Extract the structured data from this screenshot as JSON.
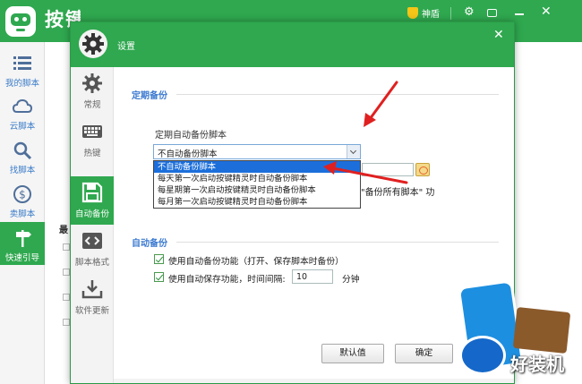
{
  "app": {
    "title": "按键精灵",
    "vip_label": "神盾"
  },
  "sidebar": {
    "items": [
      {
        "label": "我的脚本",
        "icon": "list-icon"
      },
      {
        "label": "云脚本",
        "icon": "cloud-icon"
      },
      {
        "label": "找脚本",
        "icon": "search-icon"
      },
      {
        "label": "卖脚本",
        "icon": "dollar-icon"
      },
      {
        "label": "快速引导",
        "icon": "signpost-icon"
      }
    ]
  },
  "main": {
    "partial_heading": "最"
  },
  "dialog": {
    "title": "设置",
    "nav": [
      {
        "label": "常规",
        "icon": "gear-icon"
      },
      {
        "label": "热键",
        "icon": "keyboard-icon"
      },
      {
        "label": "自动备份",
        "icon": "floppy-disk-icon"
      },
      {
        "label": "脚本格式",
        "icon": "code-icon"
      },
      {
        "label": "软件更新",
        "icon": "download-icon"
      }
    ],
    "scheduled_backup": {
      "section_title": "定期备份",
      "sub_label": "定期自动备份脚本",
      "selected": "不自动备份脚本",
      "options": [
        "不自动备份脚本",
        "每天第一次启动按键精灵时自动备份脚本",
        "每星期第一次启动按键精灵时自动备份脚本",
        "每月第一次启动按键精灵时自动备份脚本"
      ],
      "partial_text": "\"备份所有脚本\" 功"
    },
    "auto_backup": {
      "section_title": "自动备份",
      "option1_label": "使用自动备份功能（打开、保存脚本时备份）",
      "option2_label": "使用自动保存功能，时间间隔:",
      "interval_value": "10",
      "interval_unit": "分钟"
    },
    "buttons": {
      "default_label": "默认值",
      "ok_label": "确定"
    }
  },
  "watermark": {
    "text": "好装机"
  },
  "colors": {
    "accent_green": "#2fa84f",
    "section_blue": "#3c7ad0",
    "selection_blue": "#1c6fdb",
    "annotation_red": "#e02020"
  }
}
